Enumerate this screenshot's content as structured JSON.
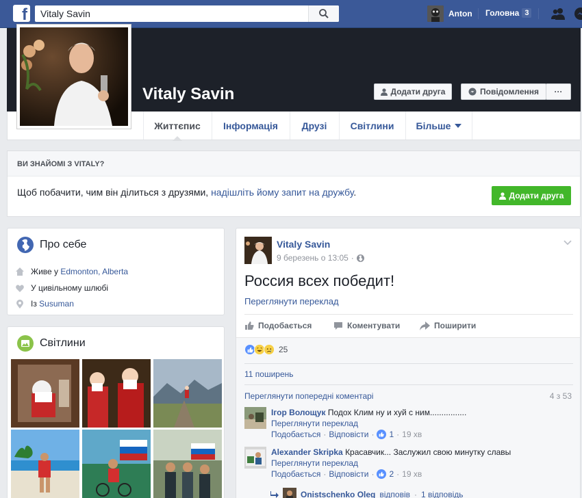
{
  "topbar": {
    "logo": "f",
    "search_value": "Vitaly Savin",
    "user_name": "Anton",
    "home_label": "Головна",
    "home_count": "3"
  },
  "profile": {
    "name": "Vitaly Savin",
    "add_friend": "Додати друга",
    "message": "Повідомлення",
    "more": "···"
  },
  "tabs": [
    {
      "label": "Життєпис"
    },
    {
      "label": "Інформація"
    },
    {
      "label": "Друзі"
    },
    {
      "label": "Світлини"
    },
    {
      "label": "Більше"
    }
  ],
  "know": {
    "heading": "ВИ ЗНАЙОМІ З VITALY?",
    "text_before": "Щоб побачити, чим він ділиться з друзями, ",
    "link": "надішліть йому запит на дружбу",
    "text_after": ".",
    "button": "Додати друга"
  },
  "about": {
    "title": "Про себе",
    "lives_prefix": "Живе у ",
    "lives_link": "Edmonton, Alberta",
    "relationship": "У цивільному шлюбі",
    "from_prefix": "Із ",
    "from_link": "Susuman"
  },
  "photos": {
    "title": "Світлини"
  },
  "post": {
    "author": "Vitaly Savin",
    "date": "9 березень о 13:05",
    "dot": "·",
    "text": "Россия всех победит!",
    "translate": "Переглянути переклад",
    "actions": {
      "like": "Подобається",
      "comment": "Коментувати",
      "share": "Поширити"
    },
    "reaction_count": "25",
    "shares": "11 поширень",
    "prev_comments": "Переглянути попередні коментарі",
    "prev_count": "4 з 53",
    "comments": [
      {
        "name": "Ігор Волощук",
        "text": "Подох Клим ну и хуй с ним................",
        "translate": "Переглянути переклад",
        "like": "Подобається",
        "reply": "Відповісти",
        "likes": "1",
        "time": "19 хв"
      },
      {
        "name": "Alexander Skripka",
        "text": "Красавчик... Заслужил свою минутку славы",
        "translate": "Переглянути переклад",
        "like": "Подобається",
        "reply": "Відповісти",
        "likes": "2",
        "time": "19 хв"
      }
    ],
    "reply_author": "Onistschenko Oleg",
    "reply_verb": "відповів",
    "reply_count": "1 відповідь",
    "sep": "·"
  },
  "colors": {
    "brand": "#3b5998",
    "link": "#365899",
    "green": "#42b72a"
  }
}
